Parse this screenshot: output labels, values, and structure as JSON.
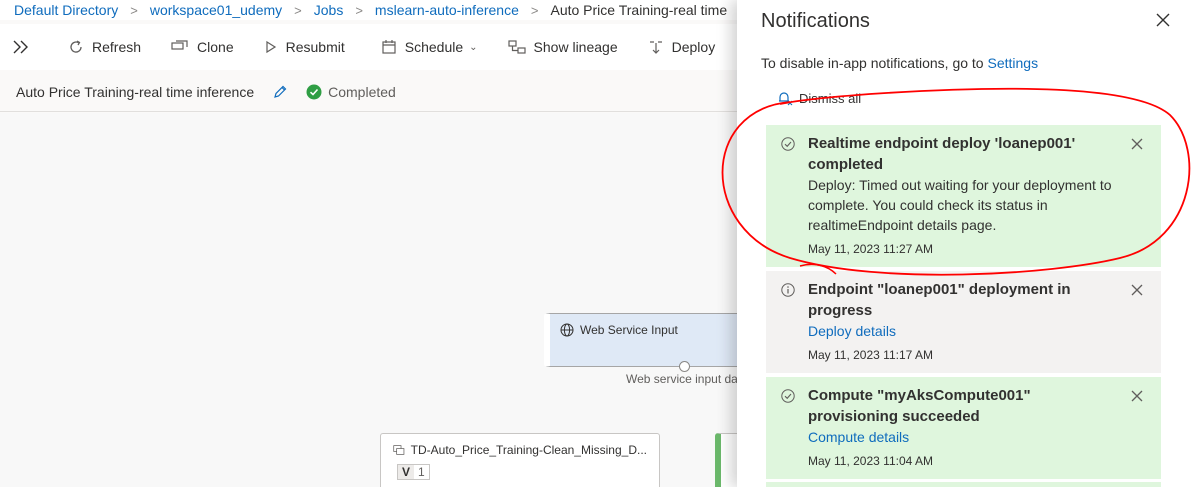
{
  "breadcrumb": {
    "items": [
      "Default Directory",
      "workspace01_udemy",
      "Jobs",
      "mslearn-auto-inference",
      "Auto Price Training-real time"
    ],
    "separator": ">"
  },
  "toolbar": {
    "refresh": "Refresh",
    "clone": "Clone",
    "resubmit": "Resubmit",
    "schedule": "Schedule",
    "show_lineage": "Show lineage",
    "deploy": "Deploy"
  },
  "job": {
    "title": "Auto Price Training-real time inference",
    "status": "Completed"
  },
  "canvas": {
    "web_service_input": "Web Service Input",
    "port_label": "Web service input da",
    "td_node_title": "TD-Auto_Price_Training-Clean_Missing_D...",
    "td_version_letter": "V",
    "td_version_number": "1"
  },
  "notifications": {
    "title": "Notifications",
    "info_text": "To disable in-app notifications, go to",
    "settings_link": "Settings",
    "dismiss_all": "Dismiss all",
    "items": [
      {
        "kind": "success",
        "title": "Realtime endpoint deploy 'loanep001' completed",
        "body": "Deploy: Timed out waiting for your deployment to complete. You could check its status in realtimeEndpoint details page.",
        "time": "May 11, 2023 11:27 AM"
      },
      {
        "kind": "info",
        "title": "Endpoint \"loanep001\" deployment in progress",
        "link": "Deploy details",
        "time": "May 11, 2023 11:17 AM"
      },
      {
        "kind": "success",
        "title": "Compute \"myAksCompute001\" provisioning succeeded",
        "link": "Compute details",
        "time": "May 11, 2023 11:04 AM"
      }
    ]
  },
  "colors": {
    "accent": "#0f6cbd",
    "success_bg": "#dff6dd",
    "info_bg": "#f3f2f1",
    "status_green": "#2f9e44",
    "annotation_red": "#ff0000"
  },
  "icons": [
    "refresh-icon",
    "clone-icon",
    "play-icon",
    "calendar-icon",
    "lineage-icon",
    "deploy-icon",
    "pencil-icon",
    "check-circle-icon",
    "close-icon",
    "dismiss-all-icon",
    "info-icon",
    "globe-icon",
    "dataset-icon"
  ]
}
